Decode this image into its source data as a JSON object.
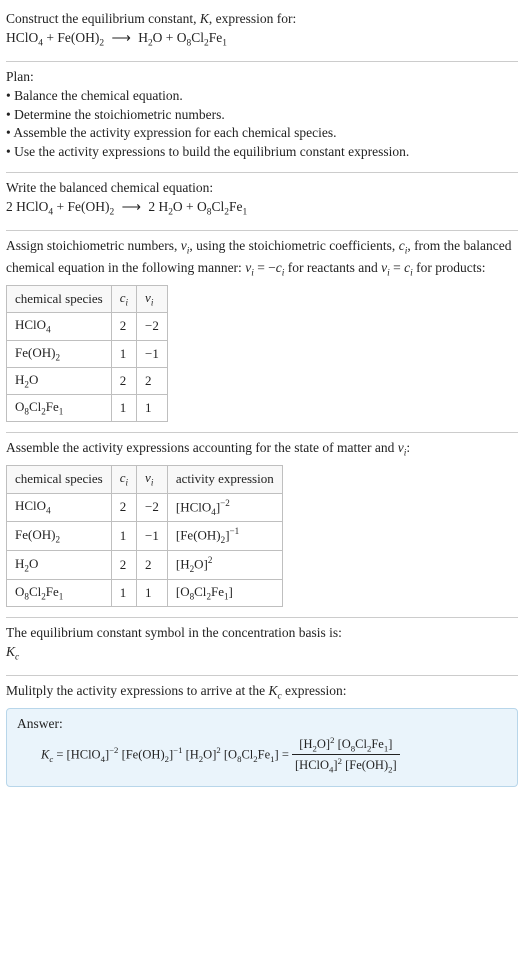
{
  "intro": {
    "line1_pre": "Construct the equilibrium constant, ",
    "line1_K": "K",
    "line1_post": ", expression for:",
    "eq_lhs_1": "HClO",
    "eq_lhs_1_sub": "4",
    "plus1": " + ",
    "eq_lhs_2": "Fe(OH)",
    "eq_lhs_2_sub": "2",
    "arrow": "⟶",
    "eq_rhs_1": "H",
    "eq_rhs_1_sub1": "2",
    "eq_rhs_1_mid": "O",
    "plus2": " + ",
    "eq_rhs_2a": "O",
    "eq_rhs_2a_sub": "8",
    "eq_rhs_2b": "Cl",
    "eq_rhs_2b_sub": "2",
    "eq_rhs_2c": "Fe",
    "eq_rhs_2c_sub": "1"
  },
  "plan": {
    "heading": "Plan:",
    "b1": "• Balance the chemical equation.",
    "b2": "• Determine the stoichiometric numbers.",
    "b3": "• Assemble the activity expression for each chemical species.",
    "b4": "• Use the activity expressions to build the equilibrium constant expression."
  },
  "balanced": {
    "heading": "Write the balanced chemical equation:",
    "c1": "2 ",
    "sp1": "HClO",
    "sp1_sub": "4",
    "plus1": " + ",
    "sp2": "Fe(OH)",
    "sp2_sub": "2",
    "arrow": "⟶",
    "c2": "2 ",
    "sp3a": "H",
    "sp3a_sub": "2",
    "sp3b": "O",
    "plus2": " + ",
    "sp4a": "O",
    "sp4a_sub": "8",
    "sp4b": "Cl",
    "sp4b_sub": "2",
    "sp4c": "Fe",
    "sp4c_sub": "1"
  },
  "stoich": {
    "heading_pre": "Assign stoichiometric numbers, ",
    "nu": "ν",
    "nu_i": "i",
    "heading_mid1": ", using the stoichiometric coefficients, ",
    "c": "c",
    "c_i": "i",
    "heading_mid2": ", from the balanced chemical equation in the following manner: ",
    "rel1a": "ν",
    "rel1b": "i",
    "rel1eq": " = −",
    "rel1c": "c",
    "rel1d": "i",
    "heading_mid3": " for reactants and ",
    "rel2a": "ν",
    "rel2b": "i",
    "rel2eq": " = ",
    "rel2c": "c",
    "rel2d": "i",
    "heading_mid4": " for products:",
    "th1": "chemical species",
    "th2_a": "c",
    "th2_b": "i",
    "th3_a": "ν",
    "th3_b": "i",
    "r1s": "HClO",
    "r1s_sub": "4",
    "r1c": "2",
    "r1v": "−2",
    "r2s": "Fe(OH)",
    "r2s_sub": "2",
    "r2c": "1",
    "r2v": "−1",
    "r3sa": "H",
    "r3sa_sub": "2",
    "r3sb": "O",
    "r3c": "2",
    "r3v": "2",
    "r4sa": "O",
    "r4sa_sub": "8",
    "r4sb": "Cl",
    "r4sb_sub": "2",
    "r4sc": "Fe",
    "r4sc_sub": "1",
    "r4c": "1",
    "r4v": "1"
  },
  "activity": {
    "heading_pre": "Assemble the activity expressions accounting for the state of matter and ",
    "nu": "ν",
    "nu_i": "i",
    "heading_post": ":",
    "th1": "chemical species",
    "th2_a": "c",
    "th2_b": "i",
    "th3_a": "ν",
    "th3_b": "i",
    "th4": "activity expression",
    "r1s": "HClO",
    "r1s_sub": "4",
    "r1c": "2",
    "r1v": "−2",
    "r1e_a": "[HClO",
    "r1e_sub": "4",
    "r1e_b": "]",
    "r1e_sup": "−2",
    "r2s": "Fe(OH)",
    "r2s_sub": "2",
    "r2c": "1",
    "r2v": "−1",
    "r2e_a": "[Fe(OH)",
    "r2e_sub": "2",
    "r2e_b": "]",
    "r2e_sup": "−1",
    "r3sa": "H",
    "r3sa_sub": "2",
    "r3sb": "O",
    "r3c": "2",
    "r3v": "2",
    "r3e_a": "[H",
    "r3e_sub": "2",
    "r3e_b": "O]",
    "r3e_sup": "2",
    "r4sa": "O",
    "r4sa_sub": "8",
    "r4sb": "Cl",
    "r4sb_sub": "2",
    "r4sc": "Fe",
    "r4sc_sub": "1",
    "r4c": "1",
    "r4v": "1",
    "r4e_a": "[O",
    "r4e_suba": "8",
    "r4e_b": "Cl",
    "r4e_subb": "2",
    "r4e_c": "Fe",
    "r4e_subc": "1",
    "r4e_d": "]"
  },
  "kc_symbol": {
    "heading": "The equilibrium constant symbol in the concentration basis is:",
    "K": "K",
    "c": "c"
  },
  "final": {
    "heading_pre": "Mulitply the activity expressions to arrive at the ",
    "K": "K",
    "c": "c",
    "heading_post": " expression:",
    "answer_label": "Answer:",
    "lhs_K": "K",
    "lhs_c": "c",
    "eq": " = ",
    "t1a": "[HClO",
    "t1sub": "4",
    "t1b": "]",
    "t1sup": "−2",
    "t2a": " [Fe(OH)",
    "t2sub": "2",
    "t2b": "]",
    "t2sup": "−1",
    "t3a": " [H",
    "t3sub": "2",
    "t3b": "O]",
    "t3sup": "2",
    "t4a": " [O",
    "t4suba": "8",
    "t4b": "Cl",
    "t4subb": "2",
    "t4c": "Fe",
    "t4subc": "1",
    "t4d": "] ",
    "eq2": "= ",
    "num1a": "[H",
    "num1sub": "2",
    "num1b": "O]",
    "num1sup": "2",
    "num2a": " [O",
    "num2suba": "8",
    "num2b": "Cl",
    "num2subb": "2",
    "num2c": "Fe",
    "num2subc": "1",
    "num2d": "]",
    "den1a": "[HClO",
    "den1sub": "4",
    "den1b": "]",
    "den1sup": "2",
    "den2a": " [Fe(OH)",
    "den2sub": "2",
    "den2b": "]"
  }
}
